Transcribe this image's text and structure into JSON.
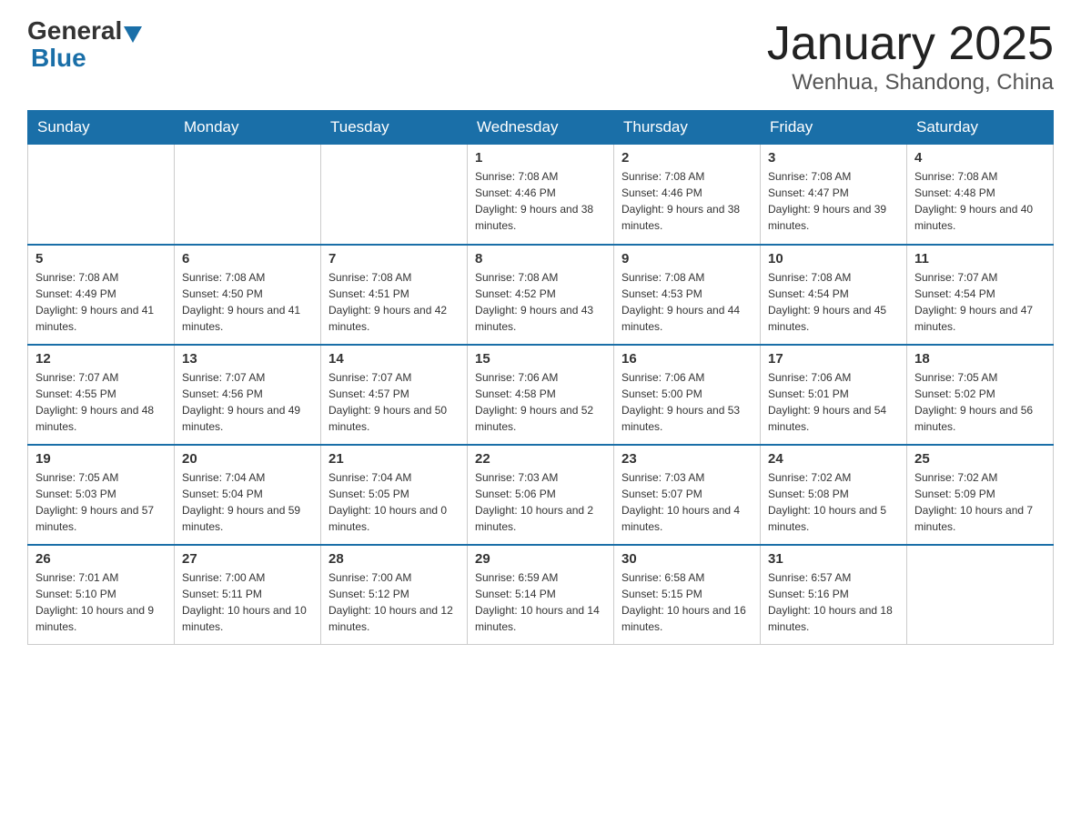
{
  "header": {
    "logo_general": "General",
    "logo_blue": "Blue",
    "month": "January 2025",
    "location": "Wenhua, Shandong, China"
  },
  "days_of_week": [
    "Sunday",
    "Monday",
    "Tuesday",
    "Wednesday",
    "Thursday",
    "Friday",
    "Saturday"
  ],
  "weeks": [
    [
      null,
      null,
      null,
      {
        "day": 1,
        "sunrise": "7:08 AM",
        "sunset": "4:46 PM",
        "daylight": "9 hours and 38 minutes."
      },
      {
        "day": 2,
        "sunrise": "7:08 AM",
        "sunset": "4:46 PM",
        "daylight": "9 hours and 38 minutes."
      },
      {
        "day": 3,
        "sunrise": "7:08 AM",
        "sunset": "4:47 PM",
        "daylight": "9 hours and 39 minutes."
      },
      {
        "day": 4,
        "sunrise": "7:08 AM",
        "sunset": "4:48 PM",
        "daylight": "9 hours and 40 minutes."
      }
    ],
    [
      {
        "day": 5,
        "sunrise": "7:08 AM",
        "sunset": "4:49 PM",
        "daylight": "9 hours and 41 minutes."
      },
      {
        "day": 6,
        "sunrise": "7:08 AM",
        "sunset": "4:50 PM",
        "daylight": "9 hours and 41 minutes."
      },
      {
        "day": 7,
        "sunrise": "7:08 AM",
        "sunset": "4:51 PM",
        "daylight": "9 hours and 42 minutes."
      },
      {
        "day": 8,
        "sunrise": "7:08 AM",
        "sunset": "4:52 PM",
        "daylight": "9 hours and 43 minutes."
      },
      {
        "day": 9,
        "sunrise": "7:08 AM",
        "sunset": "4:53 PM",
        "daylight": "9 hours and 44 minutes."
      },
      {
        "day": 10,
        "sunrise": "7:08 AM",
        "sunset": "4:54 PM",
        "daylight": "9 hours and 45 minutes."
      },
      {
        "day": 11,
        "sunrise": "7:07 AM",
        "sunset": "4:54 PM",
        "daylight": "9 hours and 47 minutes."
      }
    ],
    [
      {
        "day": 12,
        "sunrise": "7:07 AM",
        "sunset": "4:55 PM",
        "daylight": "9 hours and 48 minutes."
      },
      {
        "day": 13,
        "sunrise": "7:07 AM",
        "sunset": "4:56 PM",
        "daylight": "9 hours and 49 minutes."
      },
      {
        "day": 14,
        "sunrise": "7:07 AM",
        "sunset": "4:57 PM",
        "daylight": "9 hours and 50 minutes."
      },
      {
        "day": 15,
        "sunrise": "7:06 AM",
        "sunset": "4:58 PM",
        "daylight": "9 hours and 52 minutes."
      },
      {
        "day": 16,
        "sunrise": "7:06 AM",
        "sunset": "5:00 PM",
        "daylight": "9 hours and 53 minutes."
      },
      {
        "day": 17,
        "sunrise": "7:06 AM",
        "sunset": "5:01 PM",
        "daylight": "9 hours and 54 minutes."
      },
      {
        "day": 18,
        "sunrise": "7:05 AM",
        "sunset": "5:02 PM",
        "daylight": "9 hours and 56 minutes."
      }
    ],
    [
      {
        "day": 19,
        "sunrise": "7:05 AM",
        "sunset": "5:03 PM",
        "daylight": "9 hours and 57 minutes."
      },
      {
        "day": 20,
        "sunrise": "7:04 AM",
        "sunset": "5:04 PM",
        "daylight": "9 hours and 59 minutes."
      },
      {
        "day": 21,
        "sunrise": "7:04 AM",
        "sunset": "5:05 PM",
        "daylight": "10 hours and 0 minutes."
      },
      {
        "day": 22,
        "sunrise": "7:03 AM",
        "sunset": "5:06 PM",
        "daylight": "10 hours and 2 minutes."
      },
      {
        "day": 23,
        "sunrise": "7:03 AM",
        "sunset": "5:07 PM",
        "daylight": "10 hours and 4 minutes."
      },
      {
        "day": 24,
        "sunrise": "7:02 AM",
        "sunset": "5:08 PM",
        "daylight": "10 hours and 5 minutes."
      },
      {
        "day": 25,
        "sunrise": "7:02 AM",
        "sunset": "5:09 PM",
        "daylight": "10 hours and 7 minutes."
      }
    ],
    [
      {
        "day": 26,
        "sunrise": "7:01 AM",
        "sunset": "5:10 PM",
        "daylight": "10 hours and 9 minutes."
      },
      {
        "day": 27,
        "sunrise": "7:00 AM",
        "sunset": "5:11 PM",
        "daylight": "10 hours and 10 minutes."
      },
      {
        "day": 28,
        "sunrise": "7:00 AM",
        "sunset": "5:12 PM",
        "daylight": "10 hours and 12 minutes."
      },
      {
        "day": 29,
        "sunrise": "6:59 AM",
        "sunset": "5:14 PM",
        "daylight": "10 hours and 14 minutes."
      },
      {
        "day": 30,
        "sunrise": "6:58 AM",
        "sunset": "5:15 PM",
        "daylight": "10 hours and 16 minutes."
      },
      {
        "day": 31,
        "sunrise": "6:57 AM",
        "sunset": "5:16 PM",
        "daylight": "10 hours and 18 minutes."
      },
      null
    ]
  ],
  "labels": {
    "sunrise": "Sunrise:",
    "sunset": "Sunset:",
    "daylight": "Daylight:"
  }
}
